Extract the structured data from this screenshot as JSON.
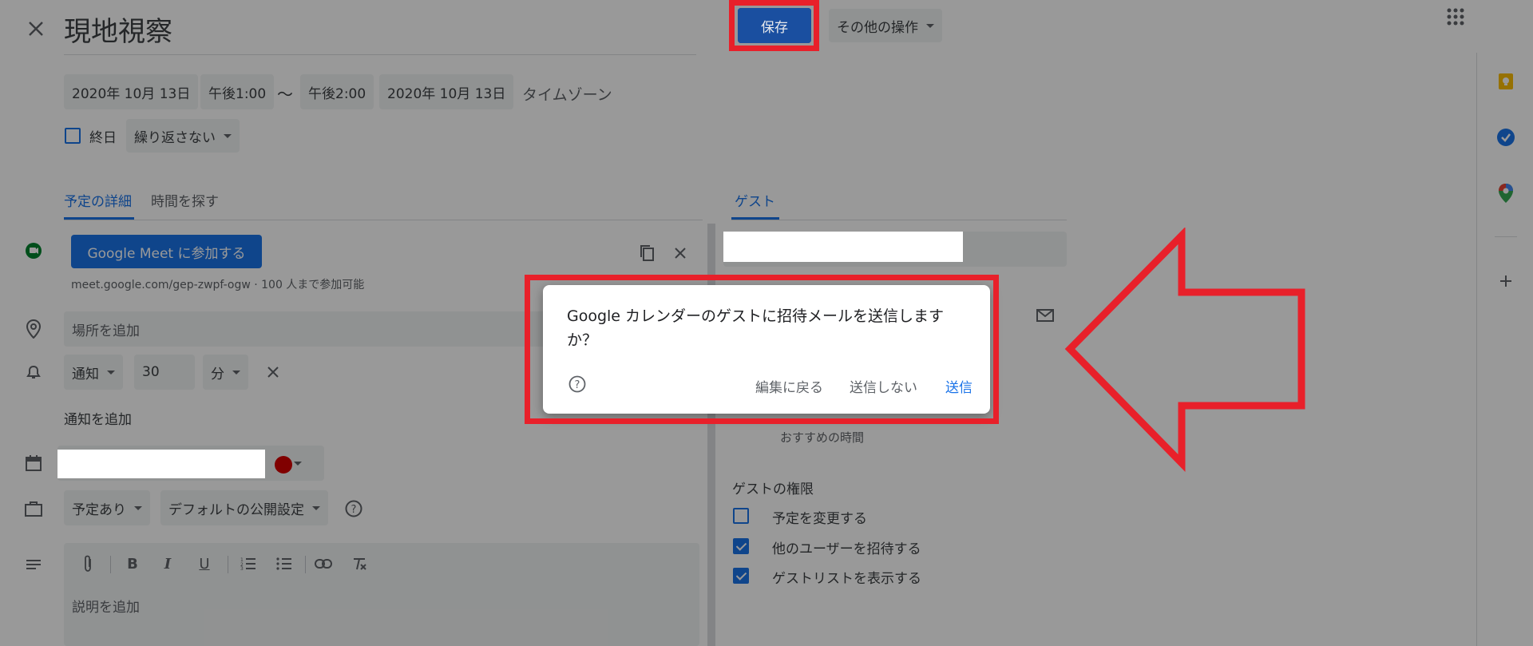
{
  "header": {
    "title": "現地視察",
    "save_label": "保存",
    "more_actions_label": "その他の操作"
  },
  "datetime": {
    "start_date": "2020年 10月 13日",
    "start_time": "午後1:00",
    "separator": "〜",
    "end_time": "午後2:00",
    "end_date": "2020年 10月 13日",
    "timezone_label": "タイムゾーン",
    "all_day_label": "終日",
    "repeat_label": "繰り返さない"
  },
  "tabs": {
    "details": "予定の詳細",
    "find_time": "時間を探す",
    "guests": "ゲスト"
  },
  "meet": {
    "join_label": "Google Meet に参加する",
    "link_text": "meet.google.com/gep-zwpf-ogw · 100 人まで参加可能"
  },
  "location": {
    "placeholder": "場所を追加"
  },
  "notification": {
    "type": "通知",
    "value": "30",
    "unit": "分",
    "add_label": "通知を追加"
  },
  "visibility": {
    "busy_label": "予定あり",
    "default_visibility": "デフォルトの公開設定"
  },
  "description": {
    "placeholder": "説明を追加"
  },
  "guests": {
    "suggested_times": "おすすめの時間",
    "permissions_title": "ゲストの権限",
    "permissions": [
      {
        "label": "予定を変更する",
        "checked": false
      },
      {
        "label": "他のユーザーを招待する",
        "checked": true
      },
      {
        "label": "ゲストリストを表示する",
        "checked": true
      }
    ]
  },
  "dialog": {
    "message": "Google カレンダーのゲストに招待メールを送信しますか？",
    "back_label": "編集に戻る",
    "dont_send_label": "送信しない",
    "send_label": "送信"
  },
  "colors": {
    "accent": "#1a73e8",
    "save_button": "#1a73e8",
    "annotation_red": "#e8202a",
    "calendar_dot": "#d50000"
  }
}
